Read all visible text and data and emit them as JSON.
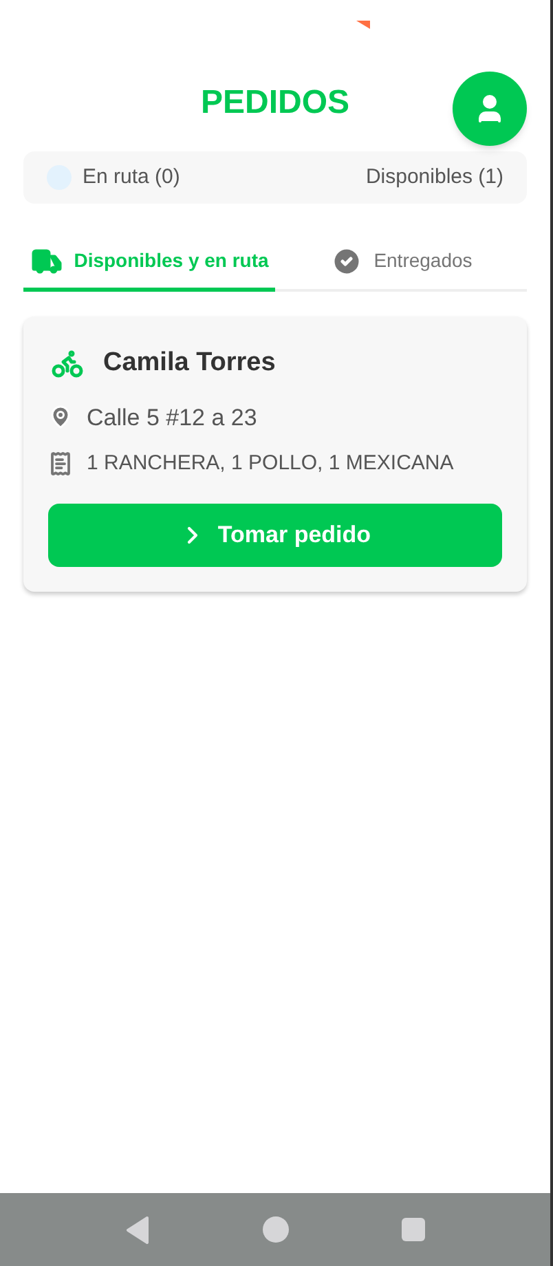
{
  "header": {
    "title": "PEDIDOS"
  },
  "summary": [
    {
      "label": "En ruta (0)",
      "color": "#e3f2fd"
    },
    {
      "label": "Disponibles (1)"
    }
  ],
  "tabs": [
    {
      "label": "Disponibles y en ruta",
      "selected": true
    },
    {
      "label": "Entregados",
      "selected": false
    }
  ],
  "orders": [
    {
      "customer": "Camila Torres",
      "address": "Calle 5 #12 a 23",
      "items": "1 RANCHERA, 1 POLLO, 1 MEXICANA",
      "action": "Tomar pedido"
    }
  ]
}
